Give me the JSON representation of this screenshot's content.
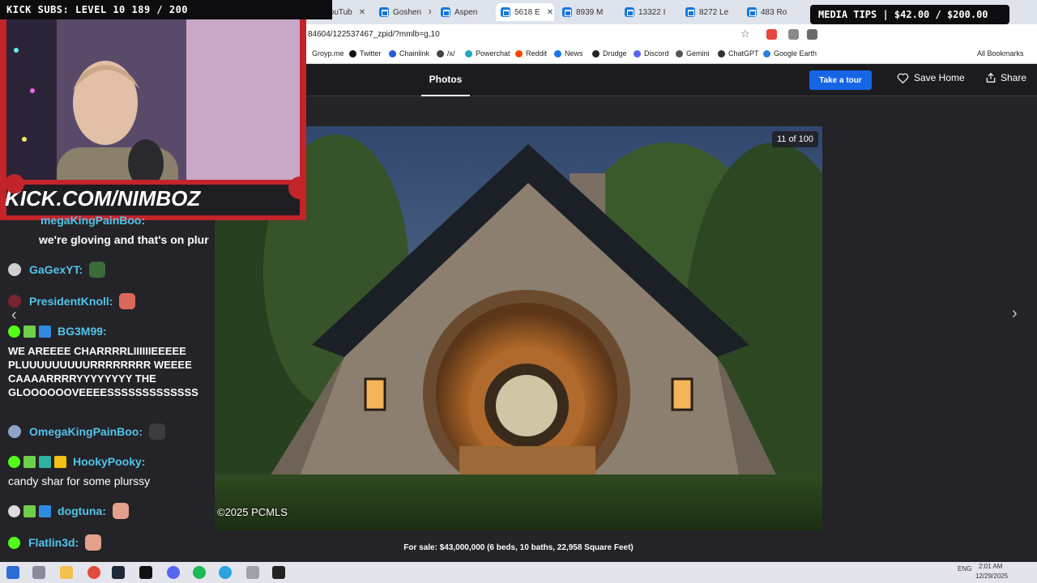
{
  "browser": {
    "tabs": [
      {
        "label": "YouTub",
        "kind": "youtube"
      },
      {
        "label": "Goshen",
        "kind": "zillow"
      },
      {
        "label": "Aspen",
        "kind": "zillow"
      },
      {
        "label": "5618 E",
        "kind": "zillow",
        "active": true
      },
      {
        "label": "8939 M",
        "kind": "zillow"
      },
      {
        "label": "13322 I",
        "kind": "zillow"
      },
      {
        "label": "8272 Le",
        "kind": "zillow"
      },
      {
        "label": "483 Ro",
        "kind": "zillow"
      }
    ],
    "url": "84604/122537467_zpid/?mmlb=g,10",
    "bookmarks": [
      {
        "label": "Groyp.me",
        "color": "#999999"
      },
      {
        "label": "Twitter",
        "color": "#111111"
      },
      {
        "label": "Chainlink",
        "color": "#2a5ada"
      },
      {
        "label": "/x/",
        "color": "#444444"
      },
      {
        "label": "Powerchat",
        "color": "#27a6c4"
      },
      {
        "label": "Reddit",
        "color": "#ff4500"
      },
      {
        "label": "News",
        "color": "#1a73e8"
      },
      {
        "label": "Drudge",
        "color": "#222222"
      },
      {
        "label": "Discord",
        "color": "#5865f2"
      },
      {
        "label": "Gemini",
        "color": "#333333"
      },
      {
        "label": "ChatGPT",
        "color": "#333333"
      },
      {
        "label": "Google Earth",
        "color": "#2a7de1"
      }
    ],
    "all_bookmarks": "All Bookmarks"
  },
  "listing": {
    "photos_tab": "Photos",
    "take_tour": "Take a tour",
    "save_home": "Save Home",
    "share": "Share",
    "counter": "11 of 100",
    "copyright": "©2025 PCMLS",
    "caption": "For sale: $43,000,000 (6 beds, 10 baths, 22,958 Square Feet)"
  },
  "overlay": {
    "kick_subs": "KICK SUBS: LEVEL 10 189 / 200",
    "media_tips": "MEDIA TIPS | $42.00 / $200.00",
    "banner": "KICK.COM/NIMBOZ"
  },
  "chat": {
    "partial_user": "megaKingPainBoo:",
    "partial_text": "we're gloving and that's on plur",
    "messages": [
      {
        "user": "GaGexYT:",
        "text": ""
      },
      {
        "user": "PresidentKnoll:",
        "text": ""
      },
      {
        "user": "BG3M99:",
        "text": "WE AREEEE CHARRRRLIIIIIIEEEEE PLUUUUUUUUURRRRRRRR WEEEE CAAAARRRRYYYYYYYY THE GLOOOOOOVEEEESSSSSSSSSSSSS"
      },
      {
        "user": "OmegaKingPainBoo:",
        "text": ""
      },
      {
        "user": "HookyPooky:",
        "text": "candy shar for some plurssy"
      },
      {
        "user": "dogtuna:",
        "text": ""
      },
      {
        "user": "Flatlin3d:",
        "text": ""
      }
    ]
  },
  "taskbar": {
    "lang": "ENG",
    "time": "2:01 AM",
    "date": "12/29/2025"
  }
}
